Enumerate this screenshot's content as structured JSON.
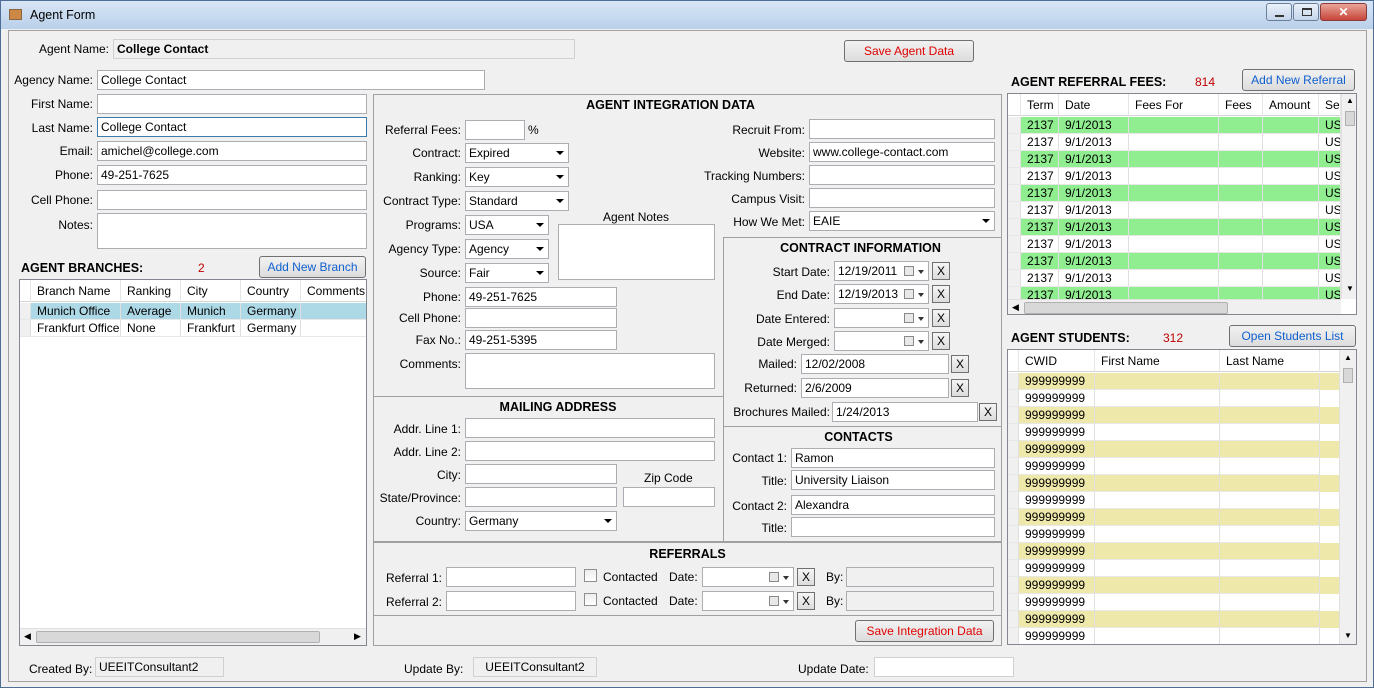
{
  "window": {
    "title": "Agent Form"
  },
  "agent": {
    "name_label": "Agent Name:",
    "name_value": "College Contact",
    "save_button": "Save Agent Data"
  },
  "contact": {
    "agency_name_label": "Agency Name:",
    "agency_name": "College Contact",
    "first_name_label": "First Name:",
    "first_name": "",
    "last_name_label": "Last Name:",
    "last_name": "College Contact",
    "email_label": "Email:",
    "email": "amichel@college.com",
    "phone_label": "Phone:",
    "phone": "49-251-7625",
    "cell_label": "Cell Phone:",
    "cell": "",
    "notes_label": "Notes:",
    "notes": ""
  },
  "branches": {
    "title": "AGENT BRANCHES:",
    "count": "2",
    "add_button": "Add New Branch",
    "columns": [
      "Branch Name",
      "Ranking",
      "City",
      "Country",
      "Comments"
    ],
    "rows": [
      [
        "Munich Office",
        "Average",
        "Munich",
        "Germany",
        ""
      ],
      [
        "Frankfurt Office",
        "None",
        "Frankfurt",
        "Germany",
        ""
      ]
    ]
  },
  "integration": {
    "title": "AGENT INTEGRATION DATA",
    "referral_fees_label": "Referral Fees:",
    "referral_fees": "",
    "pct": "%",
    "contract_label": "Contract:",
    "contract": "Expired",
    "ranking_label": "Ranking:",
    "ranking": "Key",
    "contract_type_label": "Contract Type:",
    "contract_type": "Standard",
    "programs_label": "Programs:",
    "programs": "USA",
    "agency_type_label": "Agency Type:",
    "agency_type": "Agency",
    "source_label": "Source:",
    "source": "Fair",
    "agent_notes_label": "Agent Notes",
    "phone_label": "Phone:",
    "phone": "49-251-7625",
    "cell_label": "Cell Phone:",
    "cell": "",
    "fax_label": "Fax No.:",
    "fax": "49-251-5395",
    "comments_label": "Comments:",
    "recruit_from_label": "Recruit From:",
    "recruit_from": "",
    "website_label": "Website:",
    "website": "www.college-contact.com",
    "tracking_label": "Tracking Numbers:",
    "tracking": "",
    "campus_visit_label": "Campus Visit:",
    "campus_visit": "",
    "how_we_met_label": "How We Met:",
    "how_we_met": "EAIE"
  },
  "contract_info": {
    "title": "CONTRACT INFORMATION",
    "start_label": "Start Date:",
    "start": "12/19/2011",
    "end_label": "End Date:",
    "end": "12/19/2013",
    "entered_label": "Date Entered:",
    "merged_label": "Date Merged:",
    "mailed_label": "Mailed:",
    "mailed": "12/02/2008",
    "returned_label": "Returned:",
    "returned": "2/6/2009",
    "brochures_label": "Brochures Mailed:",
    "brochures": "1/24/2013",
    "x": "X"
  },
  "mailing": {
    "title": "MAILING ADDRESS",
    "addr1_label": "Addr. Line 1:",
    "addr2_label": "Addr. Line 2:",
    "city_label": "City:",
    "zip_label": "Zip Code",
    "state_label": "State/Province:",
    "country_label": "Country:",
    "country": "Germany"
  },
  "contacts": {
    "title": "CONTACTS",
    "c1_label": "Contact 1:",
    "c1": "Ramon",
    "t1_label": "Title:",
    "t1": "University Liaison",
    "c2_label": "Contact 2:",
    "c2": "Alexandra",
    "t2_label": "Title:",
    "t2": ""
  },
  "referrals": {
    "title": "REFERRALS",
    "r1_label": "Referral 1:",
    "r2_label": "Referral 2:",
    "contacted": "Contacted",
    "date": "Date:",
    "by": "By:",
    "save_button": "Save Integration Data"
  },
  "fees": {
    "title": "AGENT REFERRAL FEES:",
    "count": "814",
    "add_button": "Add New Referral",
    "columns": [
      "Term",
      "Date",
      "Fees For",
      "Fees",
      "Amount",
      "Ser"
    ],
    "rows": [
      [
        "2137",
        "9/1/2013",
        "",
        "",
        "",
        "US"
      ],
      [
        "2137",
        "9/1/2013",
        "",
        "",
        "",
        "US"
      ],
      [
        "2137",
        "9/1/2013",
        "",
        "",
        "",
        "US"
      ],
      [
        "2137",
        "9/1/2013",
        "",
        "",
        "",
        "US"
      ],
      [
        "2137",
        "9/1/2013",
        "",
        "",
        "",
        "US"
      ],
      [
        "2137",
        "9/1/2013",
        "",
        "",
        "",
        "US"
      ],
      [
        "2137",
        "9/1/2013",
        "",
        "",
        "",
        "US"
      ],
      [
        "2137",
        "9/1/2013",
        "",
        "",
        "",
        "US"
      ],
      [
        "2137",
        "9/1/2013",
        "",
        "",
        "",
        "US"
      ],
      [
        "2137",
        "9/1/2013",
        "",
        "",
        "",
        "US"
      ],
      [
        "2137",
        "9/1/2013",
        "",
        "",
        "",
        "US"
      ]
    ],
    "highlight_color": "#90ee90"
  },
  "students": {
    "title": "AGENT STUDENTS:",
    "count": "312",
    "open_button": "Open Students List",
    "columns": [
      "CWID",
      "First Name",
      "Last Name"
    ],
    "rows": [
      [
        "999999999",
        "",
        ""
      ],
      [
        "999999999",
        "",
        ""
      ],
      [
        "999999999",
        "",
        ""
      ],
      [
        "999999999",
        "",
        ""
      ],
      [
        "999999999",
        "",
        ""
      ],
      [
        "999999999",
        "",
        ""
      ],
      [
        "999999999",
        "",
        ""
      ],
      [
        "999999999",
        "",
        ""
      ],
      [
        "999999999",
        "",
        ""
      ],
      [
        "999999999",
        "",
        ""
      ],
      [
        "999999999",
        "",
        ""
      ],
      [
        "999999999",
        "",
        ""
      ],
      [
        "999999999",
        "",
        ""
      ],
      [
        "999999999",
        "",
        ""
      ],
      [
        "999999999",
        "",
        ""
      ],
      [
        "999999999",
        "",
        ""
      ]
    ],
    "highlight_color": "#eee8aa"
  },
  "footer": {
    "created_label": "Created By:",
    "created": "UEEITConsultant2",
    "update_by_label": "Update By:",
    "update_by": "UEEITConsultant2",
    "update_date_label": "Update Date:",
    "update_date": ""
  }
}
